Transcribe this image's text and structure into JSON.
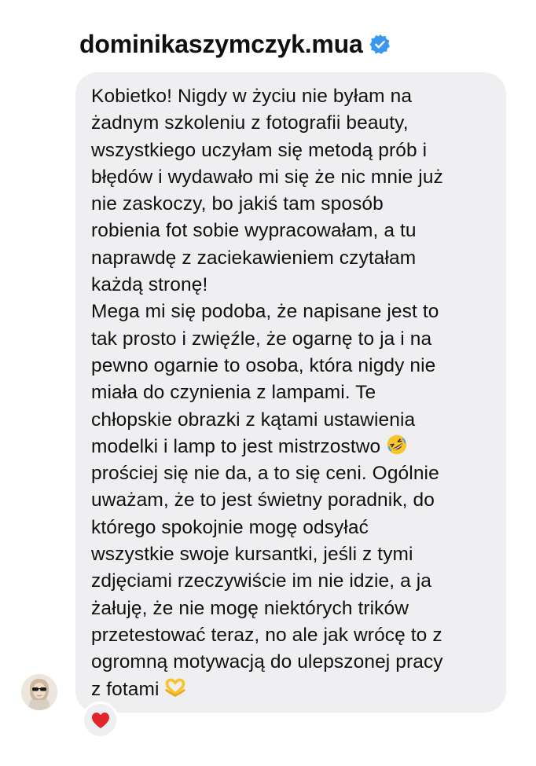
{
  "header": {
    "username": "dominikaszymczyk.mua",
    "verified_icon": "verified-badge-icon"
  },
  "message": {
    "paragraph_1": "Kobietko! Nigdy w życiu nie byłam na\nżadnym szkoleniu z fotografii beauty,\nwszystkiego uczyłam się metodą prób i\nbłędów i wydawało mi się że nic mnie już\nnie zaskoczy, bo jakiś tam sposób\nrobienia fot sobie wypracowałam, a tu\nnaprawdę z zaciekawieniem czytałam\nkażdą stronę!",
    "paragraph_2_before_emoji": "Mega mi się podoba, że napisane jest to\ntak prosto i zwięźle, że ogarnę to ja i na\npewno ogarnie to osoba, która nigdy nie\nmiała do czynienia z lampami. Te\nchłopskie obrazki z kątami ustawienia\nmodelki i lamp to jest mistrzostwo ",
    "emoji_1": "rolling-on-floor-laughing-emoji",
    "paragraph_2_after_emoji": "\nprościej się nie da, a to się ceni. Ogólnie\nuważam, że to jest świetny poradnik, do\nktórego spokojnie mogę odsyłać\nwszystkie swoje kursantki, jeśli z tymi\nzdjęciami rzeczywiście im nie idzie, a ja\nżałuję, że nie mogę niektórych trików\nprzetestować teraz, no ale jak wrócę to z\nogromną motywacją do ulepszonej pracy\nz fotami ",
    "emoji_2": "heart-hands-emoji"
  },
  "reaction": {
    "icon": "red-heart-icon"
  },
  "colors": {
    "bubble": "#efeff1",
    "verified_blue": "#3897f0",
    "heart_red": "#e0252b",
    "emoji_yellow": "#f7c52b"
  }
}
